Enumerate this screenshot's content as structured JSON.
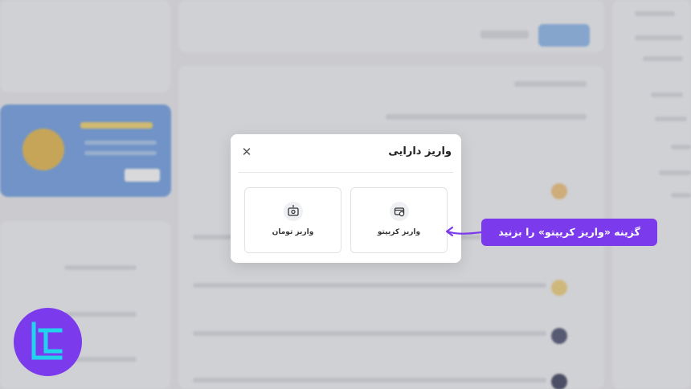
{
  "modal": {
    "title": "واریز دارایی",
    "close_symbol": "✕",
    "options": [
      {
        "label": "واریز کریپتو",
        "icon": "crypto-wallet-icon"
      },
      {
        "label": "واریز تومان",
        "icon": "toman-wallet-icon"
      }
    ]
  },
  "callout": {
    "text": "گزینه «واریز کریپتو» را بزنید"
  },
  "colors": {
    "accent": "#7c3aed",
    "modal_bg": "#ffffff",
    "overlay": "#ececef"
  }
}
